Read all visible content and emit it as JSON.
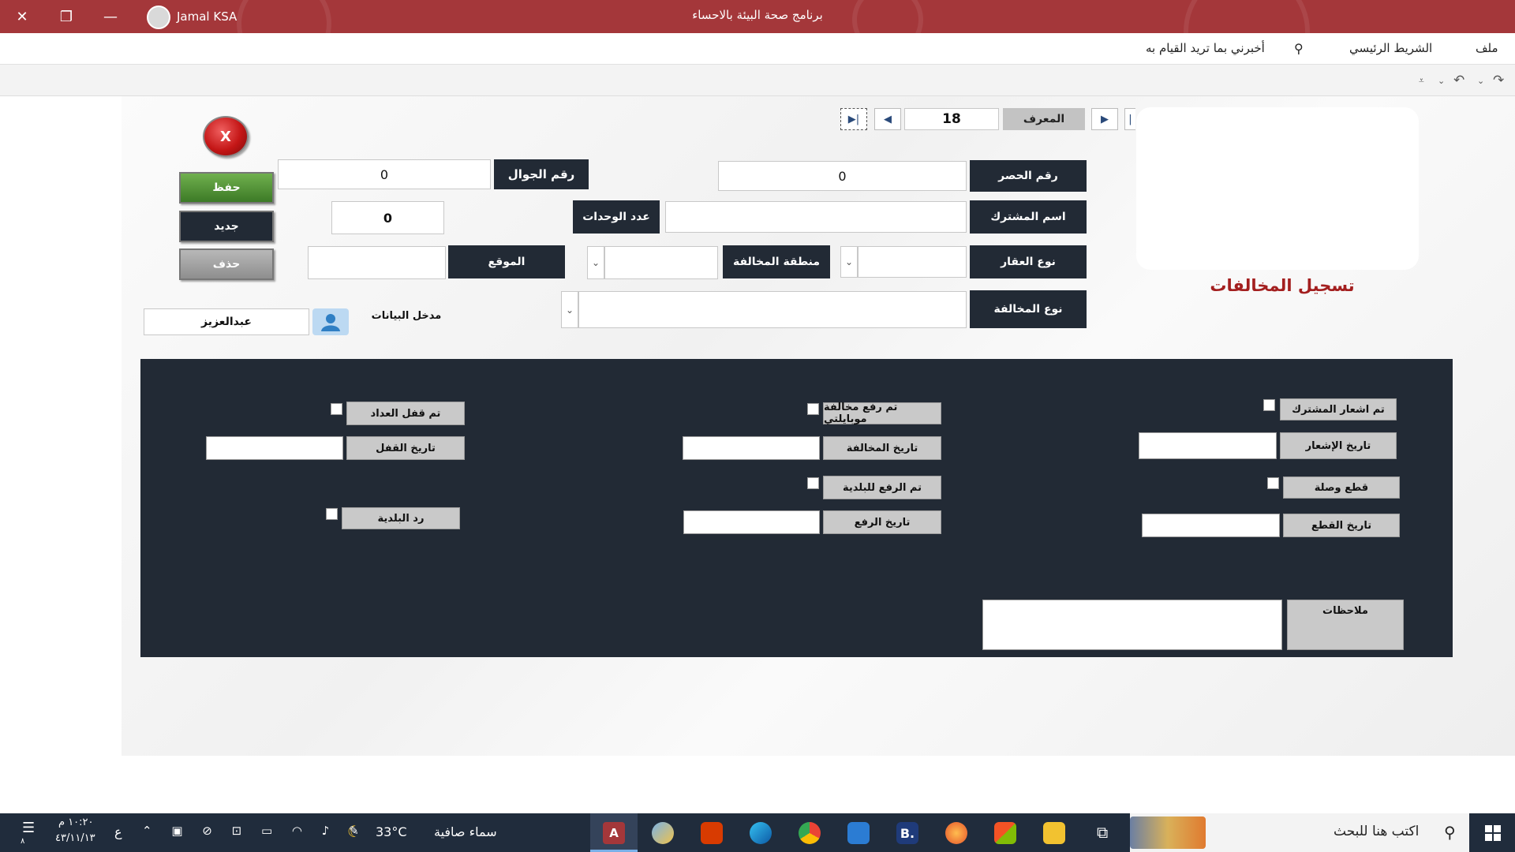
{
  "window": {
    "title": "برنامج صحة البيئة بالاحساء",
    "user": "Jamal KSA"
  },
  "ribbon": {
    "menu": [
      "ملف",
      "الشريط الرئيسي"
    ],
    "tell_me": "أخبرني بما تريد القيام به"
  },
  "form": {
    "heading": "تسجيل المخالفات",
    "nav": {
      "id_label": "المعرف",
      "id_value": "18"
    },
    "fields": {
      "inventory_no_label": "رقم الحصر",
      "inventory_no_value": "0",
      "mobile_label": "رقم الجوال",
      "mobile_value": "0",
      "subscriber_name_label": "اسم المشترك",
      "subscriber_name_value": "",
      "units_label": "عدد الوحدات",
      "units_value": "0",
      "property_type_label": "نوع العقار",
      "violation_area_label": "منطقة المخالفة",
      "location_label": "الموقع",
      "violation_type_label": "نوع المخالفة",
      "data_entry_label": "مدخل البيانات",
      "data_entry_value": "عبدالعزيز"
    },
    "buttons": {
      "save": "حفظ",
      "new": "جديد",
      "delete": "حذف",
      "close": "X"
    }
  },
  "panel": {
    "notify_subscriber": "تم اشعار المشترك",
    "notify_date": "تاريخ الإشعار",
    "cut_connection": "قطع وصلة",
    "cut_date": "تاريخ القطع",
    "mobile_violation": "تم رفع مخالفة موبايلتي",
    "violation_date": "تاريخ المخالفة",
    "raised_municipality": "تم الرفع للبلدية",
    "raise_date": "تاريخ الرفع",
    "meter_locked": "تم قفل العداد",
    "lock_date": "تاريخ القفل",
    "municipality_reply": "رد البلدية",
    "notes": "ملاحظات"
  },
  "taskbar": {
    "search": "اكتب هنا للبحث",
    "weather": "سماء صافية",
    "temperature": "33°C",
    "time": "١٠:٢٠ م",
    "date": "٤٣/١١/١٣",
    "lang": "ع",
    "notif_count": "٨"
  },
  "colors": {
    "titlebar": "#a4373a",
    "panel": "#222a35",
    "heading": "#a31f1f",
    "save_button": "#4e8f34"
  }
}
